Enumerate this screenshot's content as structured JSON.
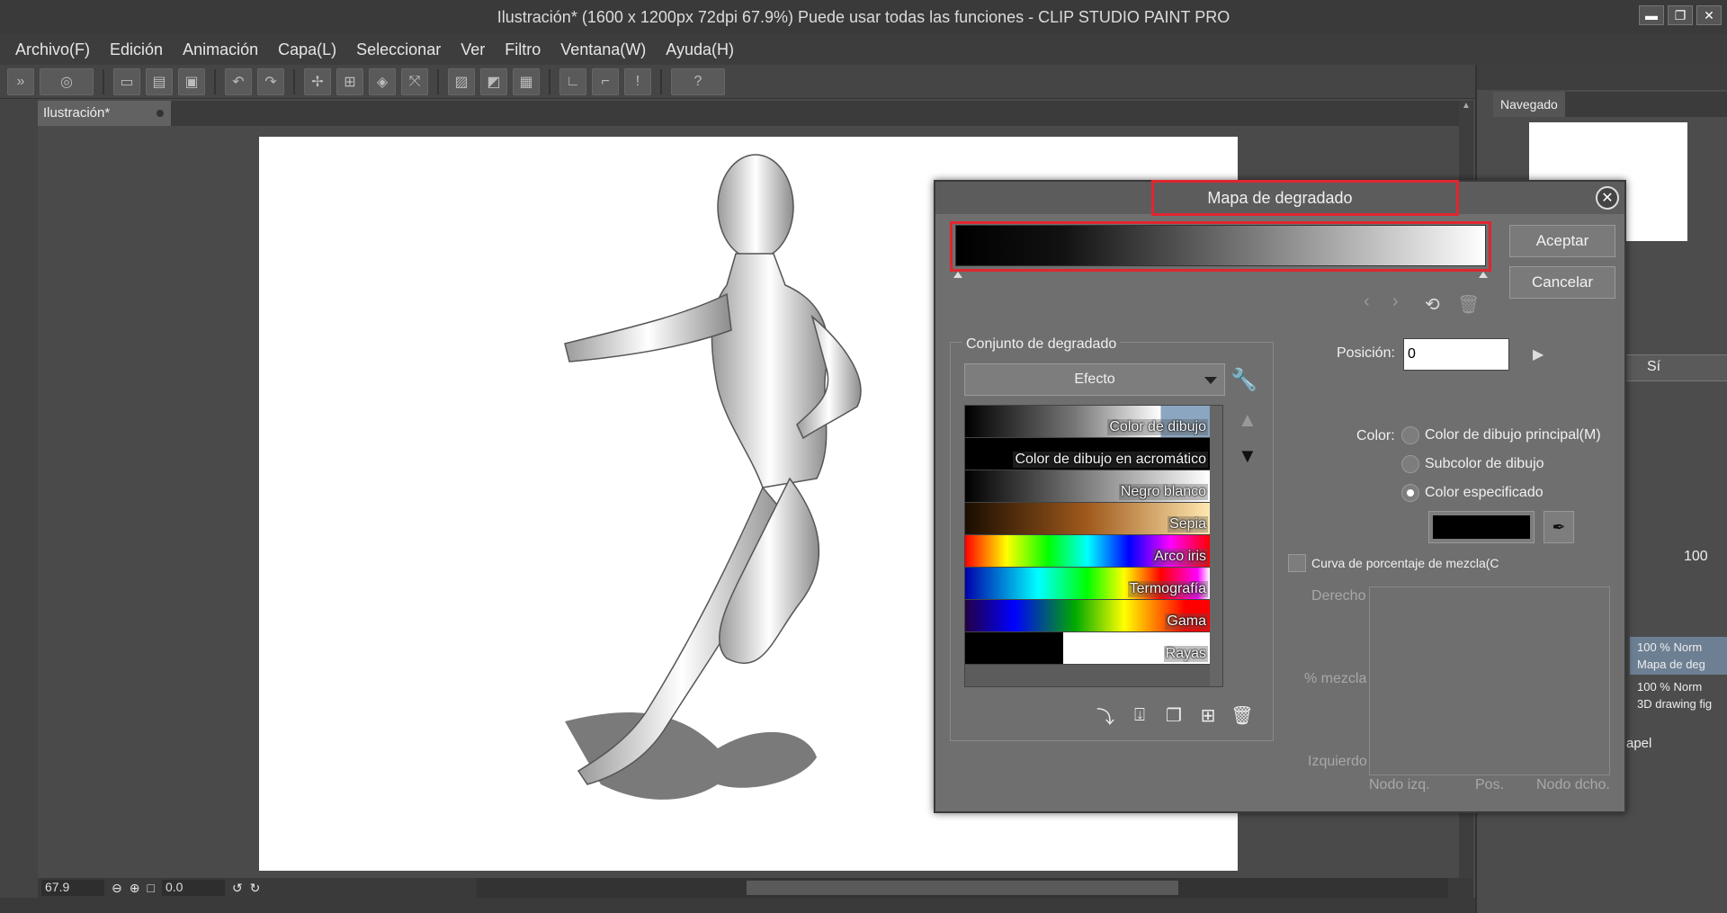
{
  "window": {
    "title": "Ilustración* (1600 x 1200px 72dpi 67.9%)  Puede usar todas las funciones - CLIP STUDIO PAINT PRO",
    "controls": [
      "▬",
      "❐",
      "✕"
    ]
  },
  "menu": [
    "Archivo(F)",
    "Edición",
    "Animación",
    "Capa(L)",
    "Seleccionar",
    "Ver",
    "Filtro",
    "Ventana(W)",
    "Ayuda(H)"
  ],
  "toolbar": {
    "icons": [
      "clip-logo-icon",
      "new-icon",
      "open-icon",
      "save-icon",
      "undo-icon",
      "redo-icon",
      "clear-icon",
      "transform-icon",
      "fill-icon",
      "scale-icon",
      "help-icon"
    ],
    "help_glyph": "?"
  },
  "document": {
    "tab_label": "Ilustración*"
  },
  "status": {
    "zoom": "67.9",
    "angle": "0.0"
  },
  "right_panel": {
    "tab_label": "Navegado",
    "dropdown_value": "Sí",
    "opacity_value": "100",
    "layers": [
      {
        "line1": "100 % Norm",
        "line2": "Mapa de deg"
      },
      {
        "line1": "100 % Norm",
        "line2": "3D drawing fig"
      }
    ],
    "paper_label": "apel"
  },
  "dialog": {
    "title": "Mapa de degradado",
    "close_glyph": "✕",
    "accept_label": "Aceptar",
    "cancel_label": "Cancelar",
    "preset_group_label": "Conjunto de degradado",
    "preset_set_value": "Efecto",
    "presets": [
      {
        "label": "Color de dibujo",
        "gradient": "linear-gradient(to right,#000,#777 45%,#fff 80%,#8aa6c0 80%,#8aa6c0)"
      },
      {
        "label": "Color de dibujo en acromático",
        "gradient": "linear-gradient(to right,#000,#000 100%)"
      },
      {
        "label": "Negro blanco",
        "gradient": "linear-gradient(to right,#000,#fff)"
      },
      {
        "label": "Sepia",
        "gradient": "linear-gradient(to right,#1a0d00,#a05a1c 50%,#ffe8b0)"
      },
      {
        "label": "Arco iris",
        "gradient": "linear-gradient(to right,#ff0000,#ffff00 17%,#00ff00 34%,#00ffff 50%,#0000ff 67%,#ff00ff 84%,#ff0000)"
      },
      {
        "label": "Termografía",
        "gradient": "linear-gradient(to right,#0000aa,#00ffff 30%,#00ff00 50%,#ffff00 65%,#ff0000 80%,#ff00ff 95%,#fff)"
      },
      {
        "label": "Gama",
        "gradient": "linear-gradient(to right,#220044,#0000ff 20%,#00aa00 45%,#ffff00 65%,#ff0000 90%)"
      },
      {
        "label": "Rayas",
        "gradient": "linear-gradient(to right,#000 0%,#000 40%,#fff 40%,#fff 100%)"
      }
    ],
    "position_label": "Posición:",
    "position_value": "0",
    "color_label": "Color:",
    "color_options": [
      {
        "label": "Color de dibujo principal(M)",
        "selected": false
      },
      {
        "label": "Subcolor de dibujo",
        "selected": false
      },
      {
        "label": "Color especificado",
        "selected": true
      }
    ],
    "specified_color": "#000000",
    "curve_checkbox_label": "Curva de porcentaje de mezcla(C",
    "curve_right_label": "Derecho",
    "curve_mix_label": "% mezcla",
    "curve_left_label": "Izquierdo",
    "curve_footer": [
      "Nodo izq.",
      "Pos.",
      "Nodo dcho."
    ]
  }
}
